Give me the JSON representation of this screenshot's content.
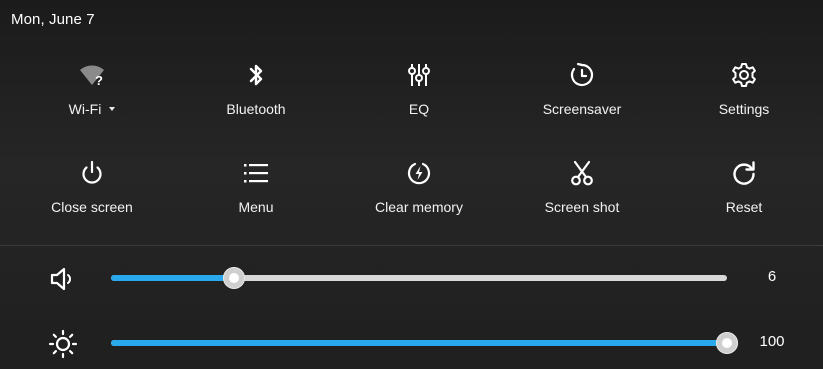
{
  "header": {
    "date": "Mon, June 7"
  },
  "tiles": [
    {
      "label": "Wi-Fi",
      "icon": "wifi-unknown-icon",
      "has_dropdown": true
    },
    {
      "label": "Bluetooth",
      "icon": "bluetooth-icon"
    },
    {
      "label": "EQ",
      "icon": "equalizer-icon"
    },
    {
      "label": "Screensaver",
      "icon": "timer-icon"
    },
    {
      "label": "Settings",
      "icon": "gear-icon"
    },
    {
      "label": "Close screen",
      "icon": "power-icon"
    },
    {
      "label": "Menu",
      "icon": "list-icon"
    },
    {
      "label": "Clear memory",
      "icon": "lightning-circle-icon"
    },
    {
      "label": "Screen shot",
      "icon": "scissors-icon"
    },
    {
      "label": "Reset",
      "icon": "refresh-icon"
    }
  ],
  "sliders": {
    "volume": {
      "icon": "speaker-icon",
      "value": "6",
      "fraction": 0.2
    },
    "brightness": {
      "icon": "sun-icon",
      "value": "100",
      "fraction": 1.0
    }
  },
  "colors": {
    "accent": "#2aa8ee",
    "track": "#d9d9d9",
    "text": "#ffffff"
  }
}
